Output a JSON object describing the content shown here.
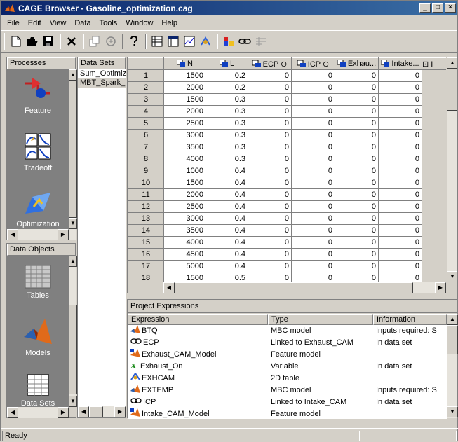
{
  "window": {
    "title": "CAGE Browser - Gasoline_optimization.cag"
  },
  "menu": [
    "File",
    "Edit",
    "View",
    "Data",
    "Tools",
    "Window",
    "Help"
  ],
  "toolbar": {
    "icons": [
      "new-file-icon",
      "open-folder-icon",
      "save-icon",
      "delete-icon",
      "copy-icon",
      "duplicate-icon",
      "help-icon",
      "table-view-icon",
      "list-view-icon",
      "chart-view-icon",
      "graph-view-icon",
      "bar-chart-icon",
      "link-icon",
      "disabled-table-icon"
    ]
  },
  "processes": {
    "header": "Processes",
    "items": [
      {
        "label": "Feature",
        "icon": "feature-icon"
      },
      {
        "label": "Tradeoff",
        "icon": "tradeoff-icon"
      },
      {
        "label": "Optimization",
        "icon": "optimization-icon"
      }
    ]
  },
  "data_objects": {
    "header": "Data Objects",
    "items": [
      {
        "label": "Tables",
        "icon": "tables-icon"
      },
      {
        "label": "Models",
        "icon": "models-icon"
      },
      {
        "label": "Data Sets",
        "icon": "datasets-icon"
      }
    ]
  },
  "datasets": {
    "header": "Data Sets",
    "items": [
      "Sum_Optimiza",
      "MBT_Spark_"
    ]
  },
  "grid": {
    "columns": [
      "N",
      "L",
      "ECP",
      "ICP",
      "Exhau...",
      "Intake...",
      "I"
    ],
    "rows": [
      [
        "1",
        "1500",
        "0.2",
        "0",
        "0",
        "0",
        "0"
      ],
      [
        "2",
        "2000",
        "0.2",
        "0",
        "0",
        "0",
        "0"
      ],
      [
        "3",
        "1500",
        "0.3",
        "0",
        "0",
        "0",
        "0"
      ],
      [
        "4",
        "2000",
        "0.3",
        "0",
        "0",
        "0",
        "0"
      ],
      [
        "5",
        "2500",
        "0.3",
        "0",
        "0",
        "0",
        "0"
      ],
      [
        "6",
        "3000",
        "0.3",
        "0",
        "0",
        "0",
        "0"
      ],
      [
        "7",
        "3500",
        "0.3",
        "0",
        "0",
        "0",
        "0"
      ],
      [
        "8",
        "4000",
        "0.3",
        "0",
        "0",
        "0",
        "0"
      ],
      [
        "9",
        "1000",
        "0.4",
        "0",
        "0",
        "0",
        "0"
      ],
      [
        "10",
        "1500",
        "0.4",
        "0",
        "0",
        "0",
        "0"
      ],
      [
        "11",
        "2000",
        "0.4",
        "0",
        "0",
        "0",
        "0"
      ],
      [
        "12",
        "2500",
        "0.4",
        "0",
        "0",
        "0",
        "0"
      ],
      [
        "13",
        "3000",
        "0.4",
        "0",
        "0",
        "0",
        "0"
      ],
      [
        "14",
        "3500",
        "0.4",
        "0",
        "0",
        "0",
        "0"
      ],
      [
        "15",
        "4000",
        "0.4",
        "0",
        "0",
        "0",
        "0"
      ],
      [
        "16",
        "4500",
        "0.4",
        "0",
        "0",
        "0",
        "0"
      ],
      [
        "17",
        "5000",
        "0.4",
        "0",
        "0",
        "0",
        "0"
      ],
      [
        "18",
        "1500",
        "0.5",
        "0",
        "0",
        "0",
        "0"
      ]
    ]
  },
  "expressions": {
    "title": "Project Expressions",
    "headers": [
      "Expression",
      "Type",
      "Information"
    ],
    "rows": [
      {
        "icon": "mbc-model-icon",
        "name": "BTQ",
        "type": "MBC model",
        "info": "Inputs required: S"
      },
      {
        "icon": "link-icon",
        "name": "ECP",
        "type": "Linked to Exhaust_CAM",
        "info": "In data set"
      },
      {
        "icon": "feature-model-icon",
        "name": "Exhaust_CAM_Model",
        "type": "Feature model",
        "info": ""
      },
      {
        "icon": "variable-icon",
        "name": "Exhaust_On",
        "type": "Variable",
        "info": "In data set"
      },
      {
        "icon": "table-2d-icon",
        "name": "EXHCAM",
        "type": "2D table",
        "info": ""
      },
      {
        "icon": "mbc-model-icon",
        "name": "EXTEMP",
        "type": "MBC model",
        "info": "Inputs required: S"
      },
      {
        "icon": "link-icon",
        "name": "ICP",
        "type": "Linked to Intake_CAM",
        "info": "In data set"
      },
      {
        "icon": "feature-model-icon",
        "name": "Intake_CAM_Model",
        "type": "Feature model",
        "info": ""
      }
    ]
  },
  "status": {
    "text": "Ready"
  }
}
